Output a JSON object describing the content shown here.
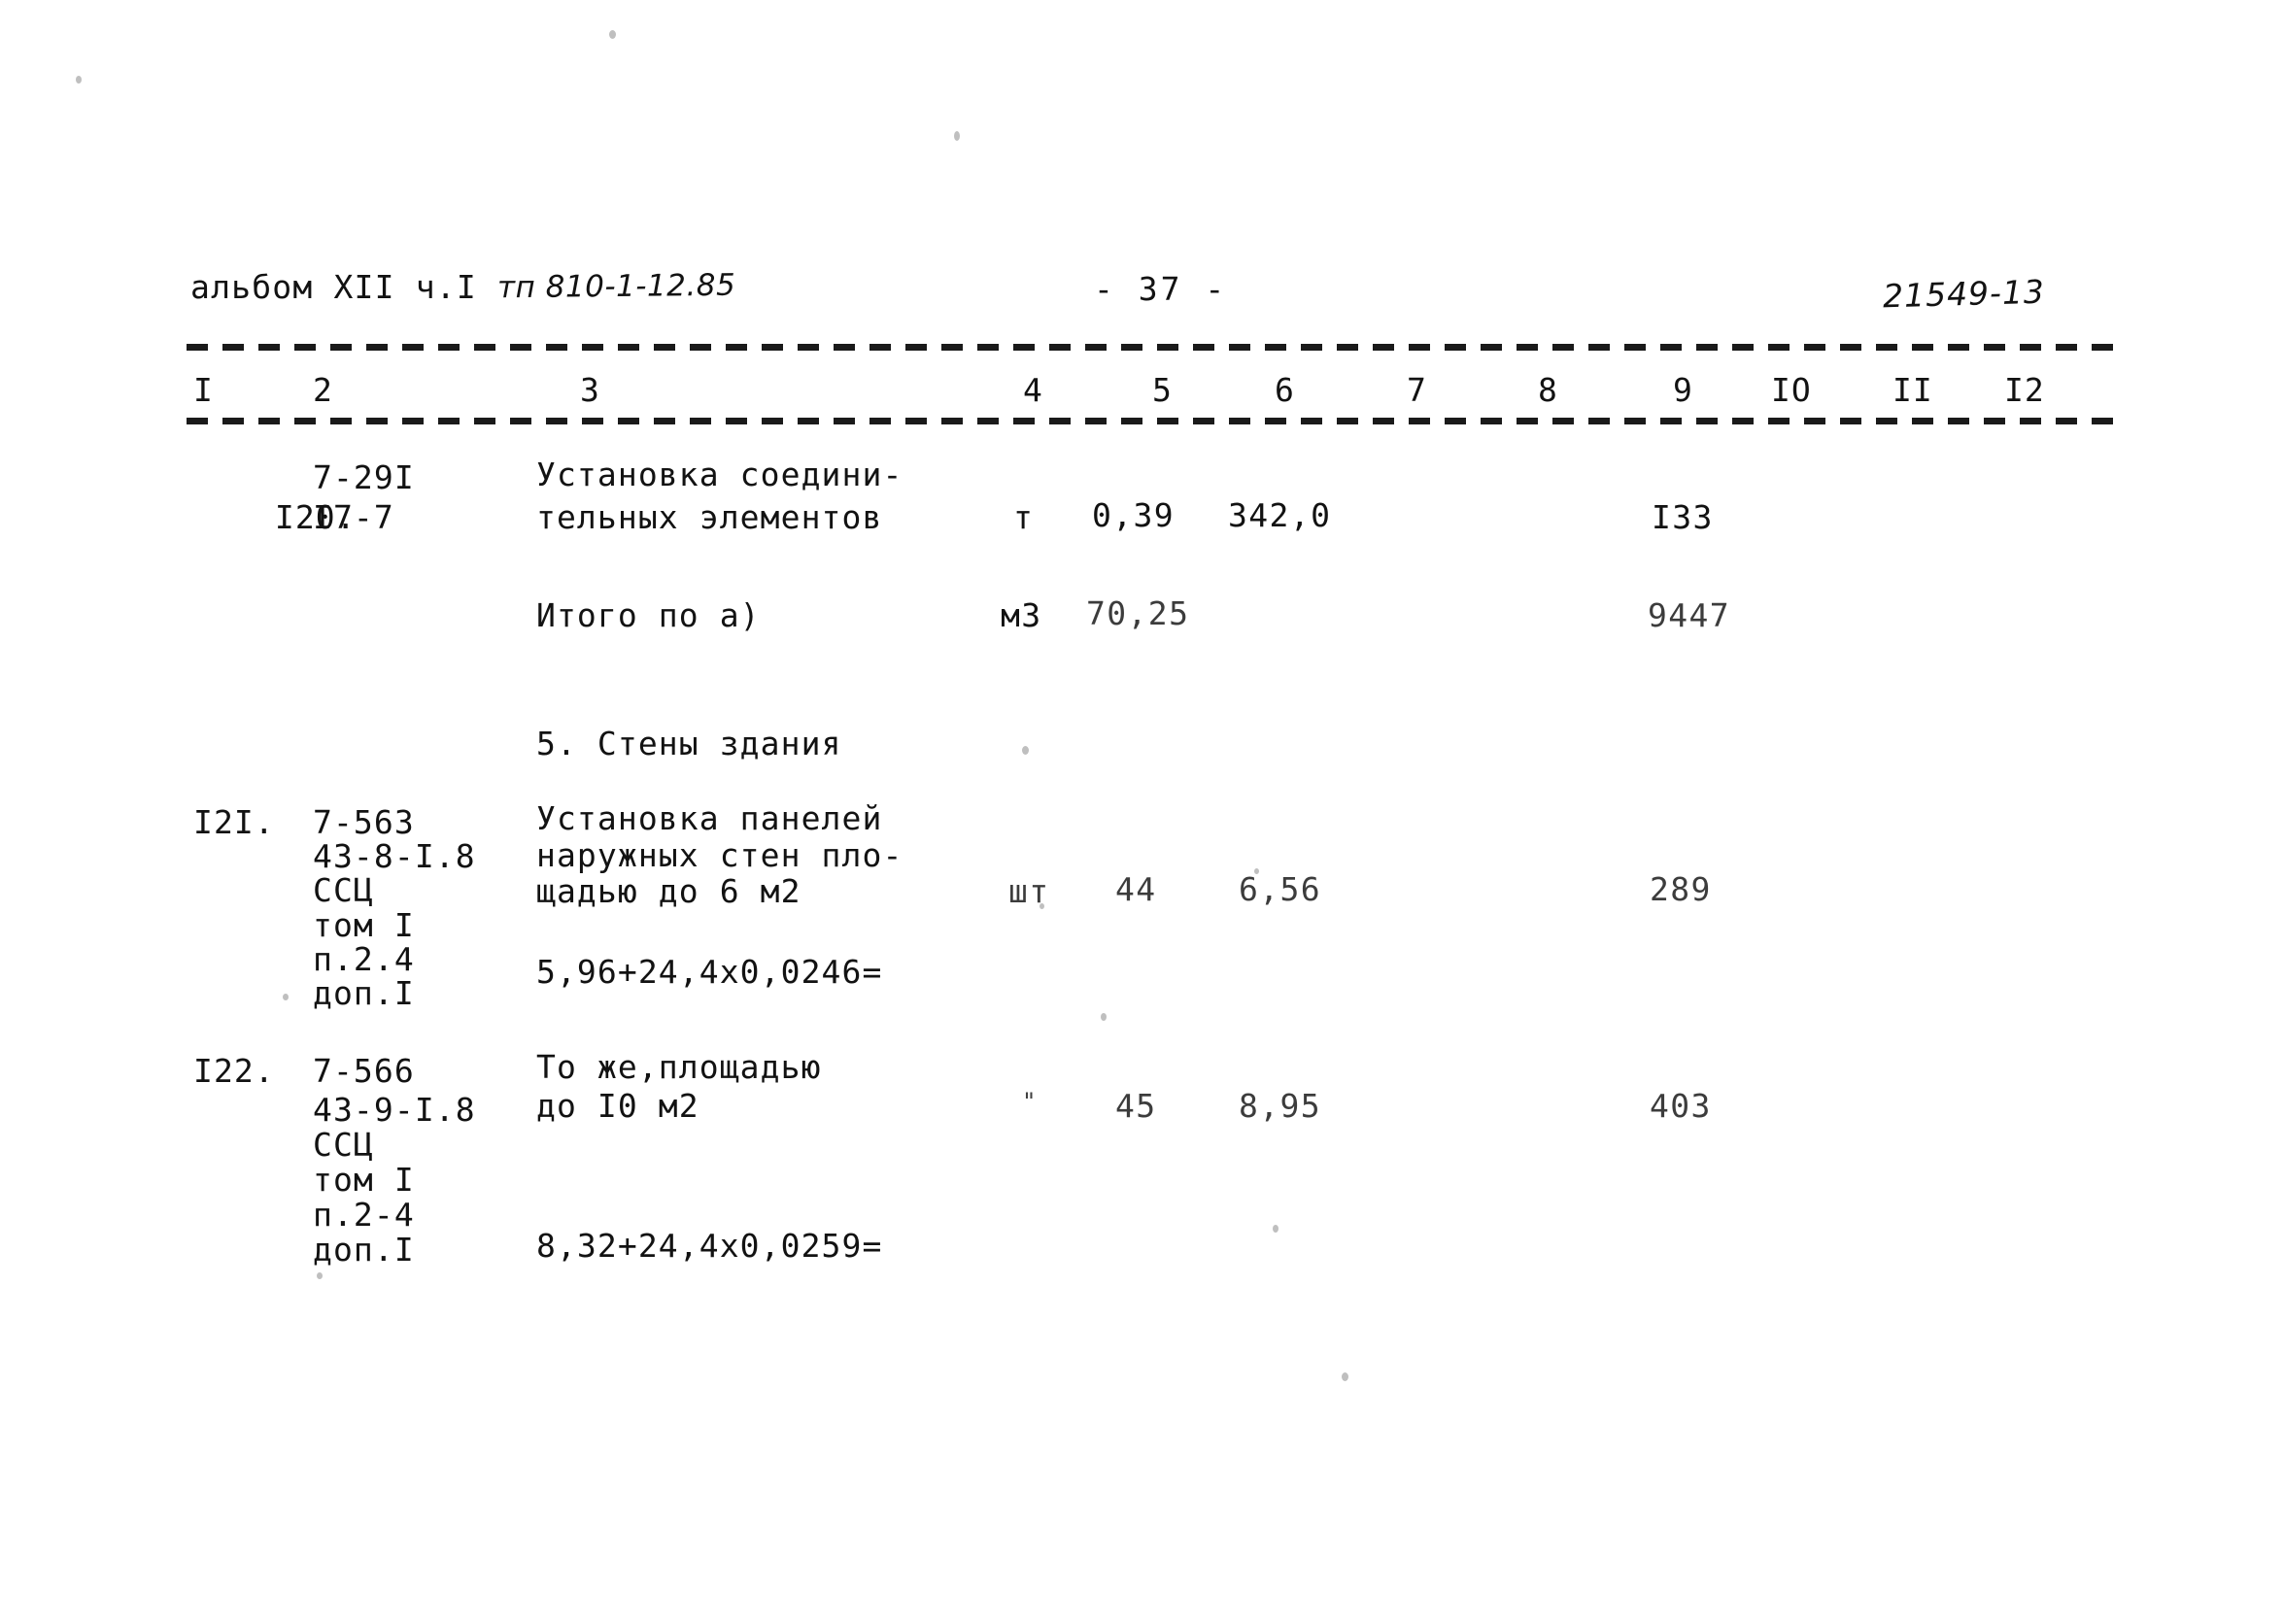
{
  "document": {
    "header_left_typed": "альбом ХII ч.I",
    "header_left_hand": "тп 810-1-12.85",
    "page_number": "- 37 -",
    "doc_number": "21549-13"
  },
  "table": {
    "column_headers": [
      "I",
      "2",
      "3",
      "4",
      "5",
      "6",
      "7",
      "8",
      "9",
      "IO",
      "II",
      "I2"
    ],
    "rows": [
      {
        "no": "I20.",
        "codes": [
          "7-29I",
          "I7-7"
        ],
        "description": [
          "Установка соедини-",
          "тельных элементов"
        ],
        "unit": "т",
        "col5": "0,39",
        "col6": "342,0",
        "col7": "",
        "col8": "",
        "col9": "I33",
        "formula": ""
      },
      {
        "no": "",
        "codes": [],
        "description": [
          "Итого по а)"
        ],
        "unit": "м3",
        "col5": "70,25",
        "col6": "",
        "col7": "",
        "col8": "",
        "col9": "9447",
        "formula": ""
      },
      {
        "no": "",
        "codes": [],
        "description": [
          "5. Стены здания"
        ],
        "unit": "",
        "col5": "",
        "col6": "",
        "col7": "",
        "col8": "",
        "col9": "",
        "formula": ""
      },
      {
        "no": "I2I.",
        "codes": [
          "7-563",
          "43-8-I.8",
          "ССЦ",
          "том I",
          "п.2.4",
          "доп.I"
        ],
        "description": [
          "Установка панелей",
          "наружных стен пло-",
          "щадью до 6 м2"
        ],
        "unit": "шт",
        "col5": "44",
        "col6": "6,56",
        "col7": "",
        "col8": "",
        "col9": "289",
        "formula": "5,96+24,4х0,0246="
      },
      {
        "no": "I22.",
        "codes": [
          "7-566",
          "43-9-I.8",
          "ССЦ",
          "том I",
          "п.2-4",
          "доп.I"
        ],
        "description": [
          "То же,площадью",
          "до I0 м2"
        ],
        "unit": "\"",
        "col5": "45",
        "col6": "8,95",
        "col7": "",
        "col8": "",
        "col9": "403",
        "formula": "8,32+24,4х0,0259="
      }
    ]
  },
  "colors": {
    "ink": "#121212",
    "paper": "#ffffff"
  }
}
